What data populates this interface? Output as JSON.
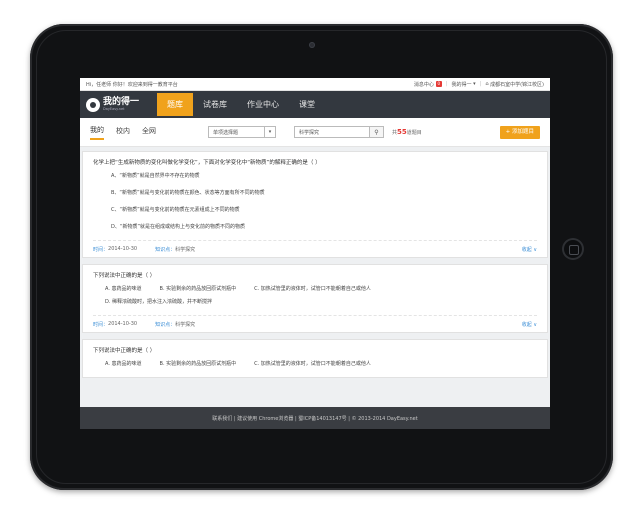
{
  "topbar": {
    "greeting": "Hi，任老师 你好！欢迎来到得一教育平台",
    "messages_label": "消息中心",
    "messages_count": "0",
    "user_label": "我的得一",
    "school": "成都石室中学(锦江校区)"
  },
  "logo": {
    "name": "我的得一",
    "sub": "DayEasy.net"
  },
  "nav": [
    {
      "label": "题库",
      "active": true
    },
    {
      "label": "试卷库",
      "active": false
    },
    {
      "label": "作业中心",
      "active": false
    },
    {
      "label": "课堂",
      "active": false
    }
  ],
  "filter": {
    "tabs": [
      {
        "label": "我的",
        "active": true
      },
      {
        "label": "校内",
        "active": false
      },
      {
        "label": "全网",
        "active": false
      }
    ],
    "type_select": "单项选择题",
    "search_value": "科学探究",
    "count_prefix": "共",
    "count_value": "55",
    "count_suffix": "道题目",
    "add_button": "+ 添加题目"
  },
  "questions": [
    {
      "title": "化学上把“生成新物质的变化叫做化学变化”，下面对化学变化中“新物质”的解释正确的是（    ）",
      "options": [
        "A、“新物质”就是自然界中不存在的物质",
        "B、“新物质”就是与变化前的物质在颜色、状态等方面有所不同的物质",
        "C、“新物质”就是与变化前的物质在元素组成上不同的物质",
        "D、“新物质”就是在组成或结构上与变化前的物质不同的物质"
      ],
      "time_label": "时间：",
      "time_value": "2014-10-30",
      "kp_label": "知识点：",
      "kp_value": "科学探究",
      "fold": "收起 ∨"
    },
    {
      "title": "下列说法中正确的是（    ）",
      "options": [
        "A. 患药品的味道",
        "B. 实验剩余的药品放回原试剂瓶中",
        "C. 加热试管里的液体时，试管口不能朝着自己或他人"
      ],
      "extra": "D. 稀释浓硫酸时，把水注入浓硫酸，并不断搅拌",
      "time_label": "时间：",
      "time_value": "2014-10-30",
      "kp_label": "知识点：",
      "kp_value": "科学探究",
      "fold": "收起 ∨"
    },
    {
      "title": "下列说法中正确的是（    ）",
      "options": [
        "A. 患药品的味道",
        "B. 实验剩余的药品放回原试剂瓶中",
        "C. 加热试管里的液体时，试管口不能朝着自己或他人"
      ]
    }
  ],
  "footer": "联系我们 | 建议使用 Chrome浏览器 | 蜀ICP备14013147号 | © 2013-2014 DayEasy.net"
}
